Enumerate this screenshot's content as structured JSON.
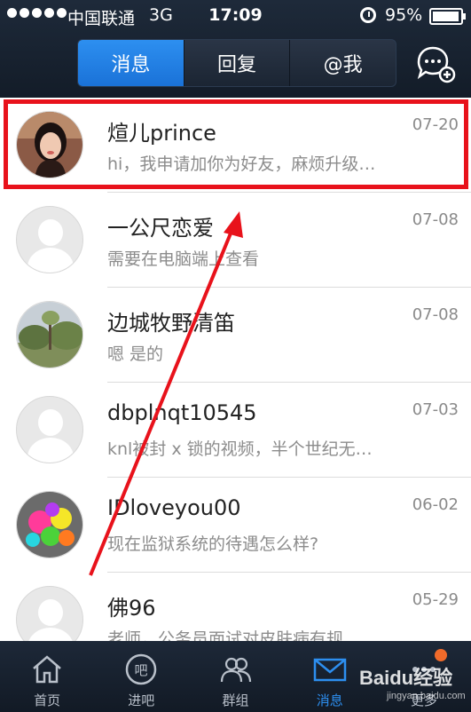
{
  "status_bar": {
    "carrier": "中国联通",
    "network": "3G",
    "time": "17:09",
    "battery": "95%",
    "battery_level": 0.95,
    "signal_bars": 5
  },
  "header": {
    "tabs": [
      {
        "label": "消息",
        "active": true
      },
      {
        "label": "回复",
        "active": false
      },
      {
        "label": "@我",
        "active": false
      }
    ],
    "compose_icon": "chat-plus-icon"
  },
  "messages": [
    {
      "name": "煊儿prince",
      "date": "07-20",
      "preview": "hi，我申请加你为好友，麻烦升级…",
      "avatar": "photo-girl",
      "highlighted": true
    },
    {
      "name": "一公尺恋爱",
      "date": "07-08",
      "preview": "需要在电脑端上查看",
      "avatar": "default-user-icon"
    },
    {
      "name": "边城牧野清笛",
      "date": "07-08",
      "preview": "嗯 是的",
      "avatar": "photo-tree"
    },
    {
      "name": "dbplnqt10545",
      "date": "07-03",
      "preview": "knl被封 x 锁的视频，半个世纪无…",
      "avatar": "default-user-icon"
    },
    {
      "name": "IDloveyou00",
      "date": "06-02",
      "preview": "现在监狱系统的待遇怎么样?",
      "avatar": "photo-balloons"
    },
    {
      "name": "佛96",
      "date": "05-29",
      "preview": "老师，公务员面试对皮肤病有规",
      "avatar": "default-user-icon"
    }
  ],
  "bottom_nav": {
    "items": [
      {
        "label": "首页",
        "icon": "home-icon",
        "active": false
      },
      {
        "label": "进吧",
        "icon": "enter-bar-icon",
        "active": false
      },
      {
        "label": "群组",
        "icon": "group-icon",
        "active": false
      },
      {
        "label": "消息",
        "icon": "mail-icon",
        "active": true
      },
      {
        "label": "更多",
        "icon": "more-icon",
        "active": false
      }
    ]
  },
  "watermark": {
    "text": "Baidu经验",
    "url": "jingyan.baidu.com"
  },
  "colors": {
    "accent": "#2d8ff0",
    "topbar": "#1e2a3a",
    "highlight": "#e8121b",
    "badge": "#f06a2a"
  }
}
